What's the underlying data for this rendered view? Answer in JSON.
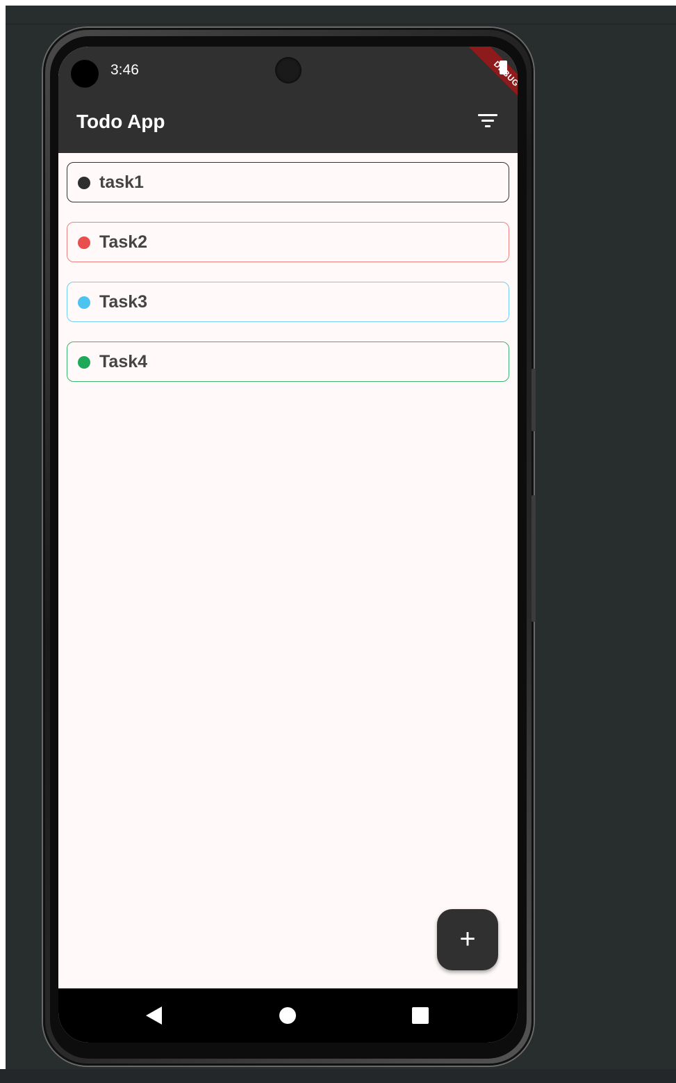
{
  "status_bar": {
    "time": "3:46",
    "debug_label": "DEBUG"
  },
  "app_bar": {
    "title": "Todo App",
    "filter_icon": "filter-list-icon"
  },
  "tasks": [
    {
      "label": "task1",
      "color": "#2f2f2f",
      "border": "#333333"
    },
    {
      "label": "Task2",
      "color": "#e85050",
      "border": "#ef8080"
    },
    {
      "label": "Task3",
      "color": "#4dc3f0",
      "border": "#74cdf2"
    },
    {
      "label": "Task4",
      "color": "#20a85a",
      "border": "#3db36d"
    }
  ],
  "fab": {
    "label": "+",
    "icon": "add-icon"
  },
  "nav_bar": {
    "back_icon": "back-triangle-icon",
    "home_icon": "home-circle-icon",
    "recents_icon": "recents-square-icon"
  },
  "colors": {
    "app_bar": "#303030",
    "background": "#fffaf9",
    "debug_banner": "#8e1b1b"
  }
}
